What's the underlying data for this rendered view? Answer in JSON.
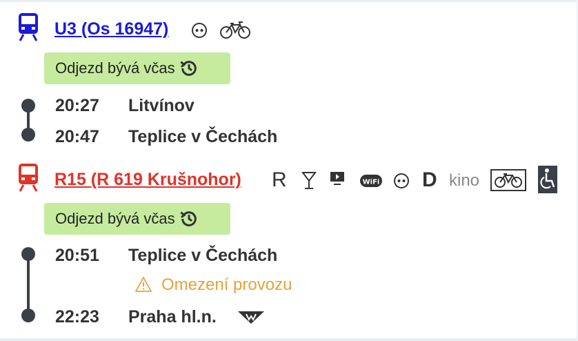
{
  "connections": [
    {
      "train_label": "U3 (Os 16947)",
      "train_color": "#1a1adb",
      "badge_text": "Odjezd bývá včas",
      "stops": [
        {
          "time": "20:27",
          "station": "Litvínov"
        },
        {
          "time": "20:47",
          "station": "Teplice v Čechách"
        }
      ],
      "icons": [
        "catering-icon",
        "bicycle-icon"
      ]
    },
    {
      "train_label": "R15 (R 619 Krušnohor)",
      "train_color": "#e0332a",
      "badge_text": "Odjezd bývá včas",
      "features": {
        "reservation": "R",
        "dining": "D",
        "cinema": "kino"
      },
      "warning": "Omezení provozu",
      "stops": [
        {
          "time": "20:51",
          "station": "Teplice v Čechách"
        },
        {
          "time": "22:23",
          "station": "Praha hl.n."
        }
      ],
      "icons": [
        "reservation-icon",
        "dining-car-icon",
        "entertainment-icon",
        "wifi-icon",
        "catering-icon",
        "bicycle-box-icon",
        "wheelchair-icon",
        "metro-icon"
      ]
    }
  ]
}
